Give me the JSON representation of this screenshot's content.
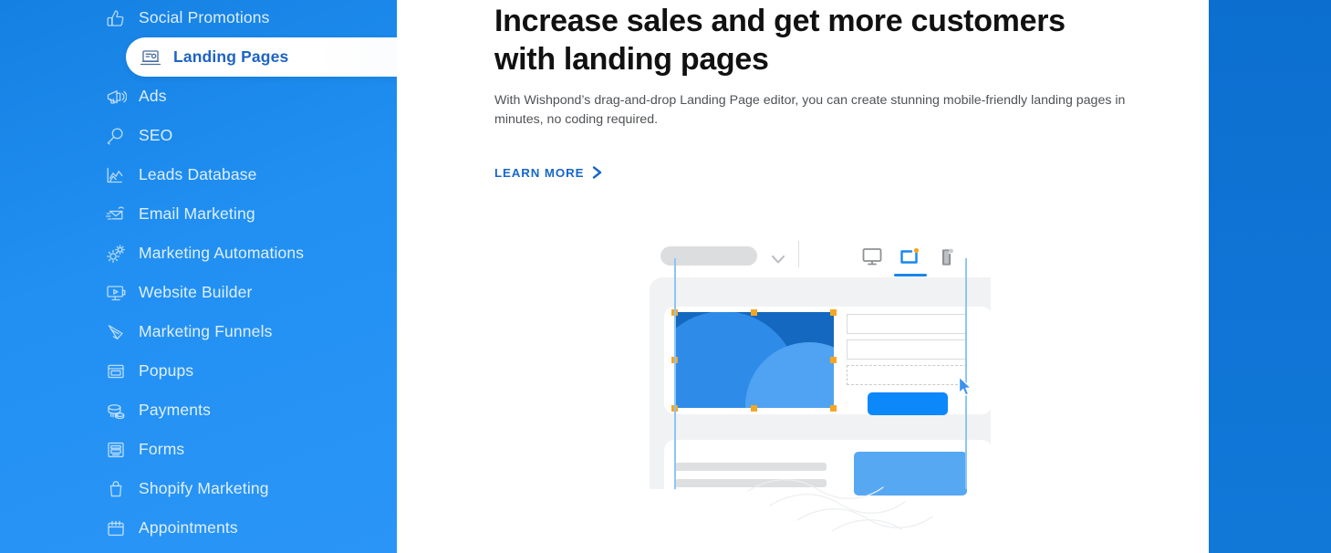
{
  "colors": {
    "sidebar_blue_top": "#1480e2",
    "sidebar_blue_bottom": "#2a95f7",
    "right_panel_blue": "#0f74d5",
    "active_item_text": "#1d63c4",
    "link_blue": "#1767c9",
    "heading_black": "#111112",
    "body_gray": "#4f5256",
    "handle_orange": "#f5a623",
    "mockup_button_blue": "#0c88fb",
    "mockup_image_dark_blue": "#1468bf"
  },
  "sidebar": {
    "items": [
      {
        "label": "Social Promotions",
        "icon": "thumbs-up-icon",
        "active": false
      },
      {
        "label": "Landing Pages",
        "icon": "laptop-page-icon",
        "active": true
      },
      {
        "label": "Ads",
        "icon": "megaphone-icon",
        "active": false
      },
      {
        "label": "SEO",
        "icon": "magnifier-icon",
        "active": false
      },
      {
        "label": "Leads Database",
        "icon": "line-chart-icon",
        "active": false
      },
      {
        "label": "Email Marketing",
        "icon": "envelope-send-icon",
        "active": false
      },
      {
        "label": "Marketing Automations",
        "icon": "gears-icon",
        "active": false
      },
      {
        "label": "Website Builder",
        "icon": "monitor-play-icon",
        "active": false
      },
      {
        "label": "Marketing Funnels",
        "icon": "funnel-icon",
        "active": false
      },
      {
        "label": "Popups",
        "icon": "popup-window-icon",
        "active": false
      },
      {
        "label": "Payments",
        "icon": "coins-stack-icon",
        "active": false
      },
      {
        "label": "Forms",
        "icon": "form-icon",
        "active": false
      },
      {
        "label": "Shopify Marketing",
        "icon": "shopping-bag-icon",
        "active": false
      },
      {
        "label": "Appointments",
        "icon": "calendar-icon",
        "active": false
      }
    ]
  },
  "main": {
    "headline": "Increase sales and get more customers with landing pages",
    "subhead": "With Wishpond’s drag-and-drop Landing Page editor, you can create stunning mobile-friendly landing pages in minutes, no coding required.",
    "cta_label": "LEARN MORE",
    "cta_icon": "chevron-right-icon"
  },
  "mockup": {
    "name": "landing-page-editor-illustration",
    "toolbar": {
      "page_selector_icon": "pill-placeholder",
      "caret_icon": "chevron-down-icon",
      "devices": [
        {
          "name": "desktop-view-icon",
          "active": false,
          "badge": false
        },
        {
          "name": "tablet-view-icon",
          "active": true,
          "badge": true
        },
        {
          "name": "mobile-view-icon",
          "active": false,
          "badge": true
        }
      ]
    },
    "canvas": {
      "selected_element": "image-block",
      "selection_handles": 8,
      "fields": [
        "text-input-field",
        "text-input-field",
        "dashed-drop-zone"
      ],
      "submit_button": "form-submit-button",
      "bottom_rows": [
        "placeholder-text-line",
        "placeholder-text-line"
      ],
      "bottom_block": "image-placeholder-block",
      "guides": [
        "vertical-guide-left",
        "vertical-guide-right"
      ],
      "cursor": "mouse-pointer-cursor"
    }
  }
}
